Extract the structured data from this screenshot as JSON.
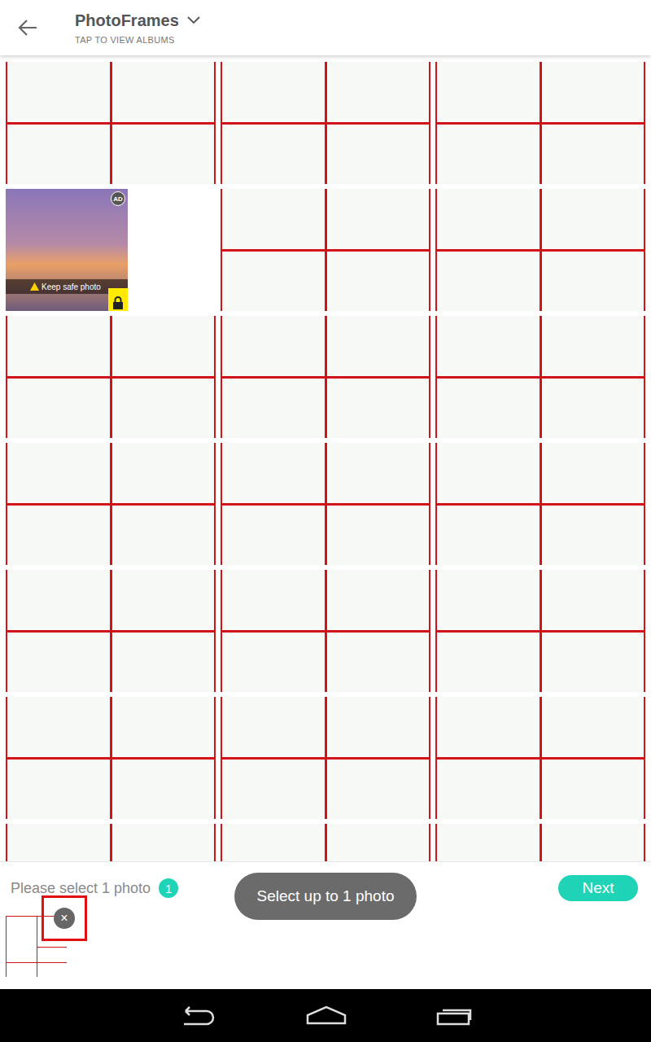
{
  "header": {
    "title": "PhotoFrames",
    "subtitle": "TAP TO VIEW ALBUMS"
  },
  "grid": [
    {
      "kind": "frame"
    },
    {
      "kind": "frame"
    },
    {
      "kind": "frame"
    },
    {
      "kind": "ad",
      "badge": "AD",
      "caption": "Keep safe photo"
    },
    {
      "kind": "frame"
    },
    {
      "kind": "frame"
    },
    {
      "kind": "frame"
    },
    {
      "kind": "frame"
    },
    {
      "kind": "frame"
    },
    {
      "kind": "frame"
    },
    {
      "kind": "frame"
    },
    {
      "kind": "frame"
    },
    {
      "kind": "frame"
    },
    {
      "kind": "frame"
    },
    {
      "kind": "frame"
    },
    {
      "kind": "frame"
    },
    {
      "kind": "frame"
    },
    {
      "kind": "frame"
    },
    {
      "kind": "frame"
    },
    {
      "kind": "frame"
    },
    {
      "kind": "frame"
    }
  ],
  "selection": {
    "prompt": "Please select 1 photo",
    "count": "1",
    "next": "Next",
    "close": "×",
    "close_highlighted": true
  },
  "toast": "Select up to 1 photo"
}
